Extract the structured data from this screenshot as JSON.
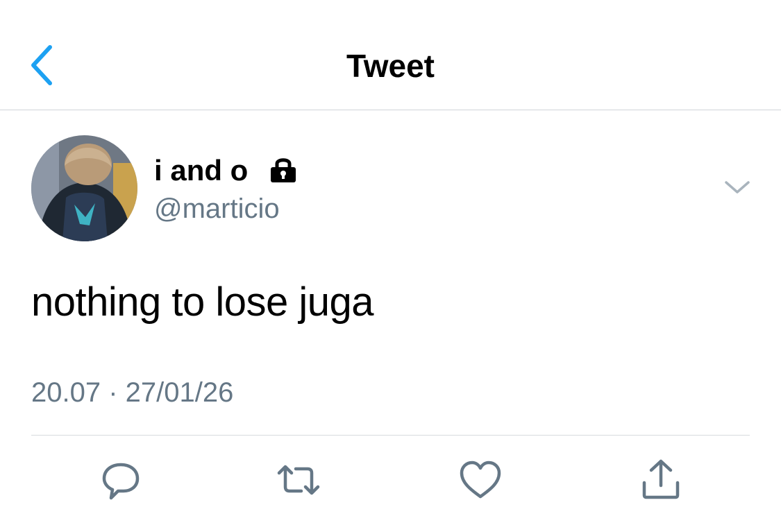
{
  "header": {
    "title": "Tweet",
    "back_icon": "chevron-left-icon"
  },
  "tweet": {
    "author": {
      "display_name": "i and o",
      "handle": "@marticio",
      "protected_icon": "lock-icon"
    },
    "menu_icon": "chevron-down-icon",
    "text": "nothing to lose juga",
    "timestamp": "20.07 · 27/01/26"
  },
  "actions": [
    {
      "name": "reply",
      "icon": "reply-icon"
    },
    {
      "name": "retweet",
      "icon": "retweet-icon"
    },
    {
      "name": "like",
      "icon": "heart-icon"
    },
    {
      "name": "share",
      "icon": "share-icon"
    }
  ],
  "colors": {
    "accent": "#1da1f2",
    "secondary_text": "#657786",
    "icon_gray": "#657786",
    "divider": "#cfd4d8"
  }
}
